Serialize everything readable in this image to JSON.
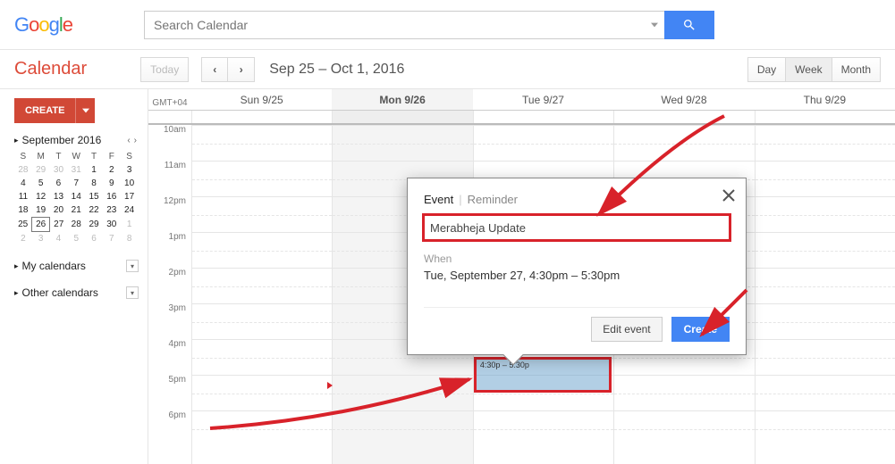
{
  "header": {
    "logo_text": "Google",
    "search_placeholder": "Search Calendar"
  },
  "toolbar": {
    "app_title": "Calendar",
    "today_label": "Today",
    "date_range": "Sep 25 – Oct 1, 2016",
    "views": [
      "Day",
      "Week",
      "Month"
    ],
    "active_view": "Week"
  },
  "sidebar": {
    "create_label": "CREATE",
    "month_label": "September 2016",
    "dow": [
      "S",
      "M",
      "T",
      "W",
      "T",
      "F",
      "S"
    ],
    "weeks": [
      [
        {
          "d": "28",
          "off": true
        },
        {
          "d": "29",
          "off": true
        },
        {
          "d": "30",
          "off": true
        },
        {
          "d": "31",
          "off": true
        },
        {
          "d": "1"
        },
        {
          "d": "2"
        },
        {
          "d": "3"
        }
      ],
      [
        {
          "d": "4"
        },
        {
          "d": "5"
        },
        {
          "d": "6"
        },
        {
          "d": "7"
        },
        {
          "d": "8"
        },
        {
          "d": "9"
        },
        {
          "d": "10"
        }
      ],
      [
        {
          "d": "11"
        },
        {
          "d": "12"
        },
        {
          "d": "13"
        },
        {
          "d": "14"
        },
        {
          "d": "15"
        },
        {
          "d": "16"
        },
        {
          "d": "17"
        }
      ],
      [
        {
          "d": "18"
        },
        {
          "d": "19"
        },
        {
          "d": "20"
        },
        {
          "d": "21"
        },
        {
          "d": "22"
        },
        {
          "d": "23"
        },
        {
          "d": "24"
        }
      ],
      [
        {
          "d": "25"
        },
        {
          "d": "26",
          "today": true
        },
        {
          "d": "27"
        },
        {
          "d": "28"
        },
        {
          "d": "29"
        },
        {
          "d": "30"
        },
        {
          "d": "1",
          "off": true
        }
      ],
      [
        {
          "d": "2",
          "off": true
        },
        {
          "d": "3",
          "off": true
        },
        {
          "d": "4",
          "off": true
        },
        {
          "d": "5",
          "off": true
        },
        {
          "d": "6",
          "off": true
        },
        {
          "d": "7",
          "off": true
        },
        {
          "d": "8",
          "off": true
        }
      ]
    ],
    "my_cal": "My calendars",
    "other_cal": "Other calendars"
  },
  "grid": {
    "tz": "GMT+04",
    "days": [
      "Sun 9/25",
      "Mon 9/26",
      "Tue 9/27",
      "Wed 9/28",
      "Thu 9/29"
    ],
    "active_day_index": 1,
    "hours": [
      "10am",
      "11am",
      "12pm",
      "1pm",
      "2pm",
      "3pm",
      "4pm",
      "5pm",
      "6pm"
    ],
    "event_time_label": "4:30p – 5:30p"
  },
  "popup": {
    "tab_event": "Event",
    "tab_reminder": "Reminder",
    "title_value": "Merabheja Update",
    "when_label": "When",
    "when_text": "Tue, September 27, 4:30pm – 5:30pm",
    "edit_label": "Edit event",
    "create_label": "Create"
  }
}
